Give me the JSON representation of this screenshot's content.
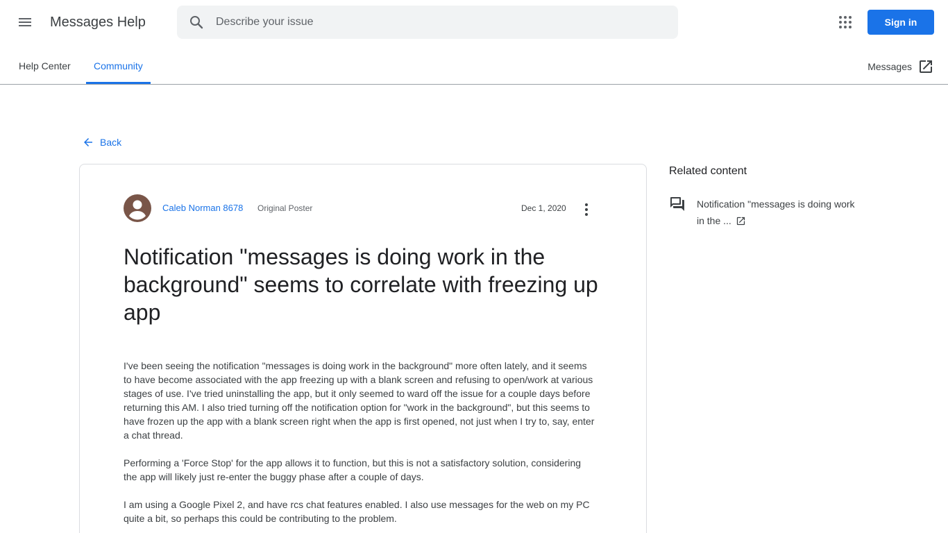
{
  "header": {
    "app_title": "Messages Help",
    "search_placeholder": "Describe your issue",
    "sign_in_label": "Sign in"
  },
  "tabs": {
    "help_center": "Help Center",
    "community": "Community",
    "product_link": "Messages"
  },
  "nav": {
    "back_label": "Back"
  },
  "post": {
    "author": "Caleb Norman 8678",
    "author_role": "Original Poster",
    "date": "Dec 1, 2020",
    "title": "Notification \"messages is doing work in the background\" seems to correlate with freezing up app",
    "paragraphs": [
      "I've been seeing the notification \"messages is doing work in the background\" more often lately, and it seems to have become associated with the app freezing up with a blank screen and refusing to open/work at various stages of use. I've tried uninstalling the app, but it only seemed to ward off the issue for a couple days before returning this AM. I also tried turning off the notification option for \"work in the background\", but this seems to have frozen up the app with a blank screen right when the app is first opened, not just when I try to, say, enter a chat thread.",
      "Performing a 'Force Stop' for the app allows it to function, but this is not a satisfactory solution, considering the app will likely just re-enter the buggy phase after a couple of days.",
      "I am using a Google Pixel 2, and have rcs chat features enabled. I also use messages for the web on my PC quite a bit, so perhaps this could be contributing to the problem."
    ]
  },
  "related": {
    "title": "Related content",
    "items": [
      {
        "label": "Notification \"messages is doing work in the ..."
      }
    ]
  },
  "colors": {
    "accent": "#1a73e8",
    "text_primary": "#202124",
    "text_secondary": "#5f6368",
    "search_bg": "#f1f3f4",
    "avatar": "#795548"
  },
  "icons": {
    "menu": "hamburger-menu-icon",
    "search": "search-icon",
    "apps": "apps-grid-icon",
    "external": "open-in-new-icon",
    "back": "arrow-back-icon",
    "avatar": "account-circle-icon",
    "more": "more-vert-icon",
    "forum": "forum-icon"
  }
}
